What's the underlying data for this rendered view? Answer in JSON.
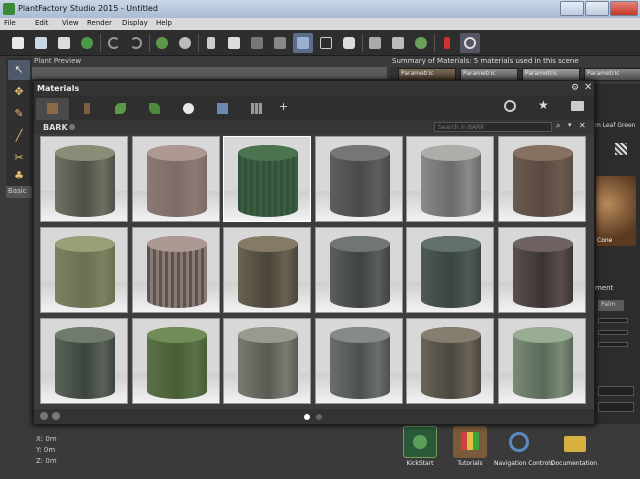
{
  "window": {
    "title": "PlantFactory Studio 2015 - Untitled"
  },
  "menu": [
    "File",
    "Edit",
    "View",
    "Render",
    "Display",
    "Help"
  ],
  "toolbar": {
    "buttons": [
      "new-file-icon",
      "open-folder-icon",
      "save-icon",
      "plant-download-icon",
      "undo-icon",
      "redo-icon",
      "plant-icon",
      "plant-settings-icon",
      "cut-icon",
      "copy-icon",
      "paste-icon",
      "delete-icon",
      "view-icon",
      "frame-icon",
      "camera-icon",
      "render-icon",
      "render-settings-icon",
      "plant-view-icon",
      "brush-icon",
      "clock-icon"
    ]
  },
  "left_tools": [
    "select-arrow-icon",
    "move-nodes-icon",
    "pencil-icon",
    "brush-icon",
    "cut-icon",
    "trunk-icon"
  ],
  "left_tab": "Basic",
  "plant_preview": {
    "header": "Plant Preview"
  },
  "summary": {
    "header": "Summary of Materials: 5 materials used in this scene",
    "thumbs": [
      "Parametric",
      "Parametric",
      "Parametric",
      "Parametric",
      "Parametric"
    ]
  },
  "right_panel": {
    "leaf_label": "m Leaf Green",
    "cone_label": "Cone",
    "ment_label": "ment",
    "palm_label": "Palm"
  },
  "coords": {
    "x": "X: 0m",
    "y": "Y: 0m",
    "z": "Z: 0m"
  },
  "launcher": {
    "items": [
      "KickStart",
      "Tutorials",
      "Navigation Controls",
      "Documentation"
    ]
  },
  "materials": {
    "title": "Materials",
    "tabs": [
      "bark-tab-icon",
      "branch-tab-icon",
      "leaf-tab-icon",
      "leaf2-tab-icon",
      "flower-tab-icon",
      "folder-tab-icon",
      "grid-tab-icon"
    ],
    "category": "BARK",
    "search_placeholder": "Search in BARK",
    "active_page": 1,
    "page_count": 2,
    "grid": [
      {
        "top": "#6e7060",
        "side": "#4c5048",
        "style": "rough"
      },
      {
        "top": "#8a7a74",
        "side": "#7d6a68",
        "style": "pink"
      },
      {
        "top": "#3d5c40",
        "side": "#2f5238",
        "style": "green-stripe"
      },
      {
        "top": "#5e5e5e",
        "side": "#4a4a4a",
        "style": "gray"
      },
      {
        "top": "#8a8a88",
        "side": "#6a6a6a",
        "style": "birch"
      },
      {
        "top": "#6a5a4e",
        "side": "#5a4a40",
        "style": "brown"
      },
      {
        "top": "#7a8060",
        "side": "#6a7050",
        "style": "green-gray"
      },
      {
        "top": "#8a7a76",
        "side": "#5e524e",
        "style": "brown-stripe"
      },
      {
        "top": "#6a6250",
        "side": "#4a443a",
        "style": "rough-brown"
      },
      {
        "top": "#5a5e5e",
        "side": "#3e4242",
        "style": "dark-gray"
      },
      {
        "top": "#4e5a56",
        "side": "#3a4442",
        "style": "dark-green"
      },
      {
        "top": "#5a4e4e",
        "side": "#3c3434",
        "style": "dark-brown"
      },
      {
        "top": "#5a6258",
        "side": "#3c4440",
        "style": "moss"
      },
      {
        "top": "#5a7046",
        "side": "#4a5e36",
        "style": "mossy-green"
      },
      {
        "top": "#7a7a72",
        "side": "#5a5a52",
        "style": "light-gray"
      },
      {
        "top": "#6a6e6e",
        "side": "#4c5050",
        "style": "gray-rough"
      },
      {
        "top": "#6a6458",
        "side": "#4a4640",
        "style": "checker"
      },
      {
        "top": "#7a8a76",
        "side": "#5a6a5a",
        "style": "green-top"
      }
    ]
  },
  "colors": {
    "accent_tab": "#4a4a4a",
    "dialog_bg": "#3d3d3d"
  }
}
